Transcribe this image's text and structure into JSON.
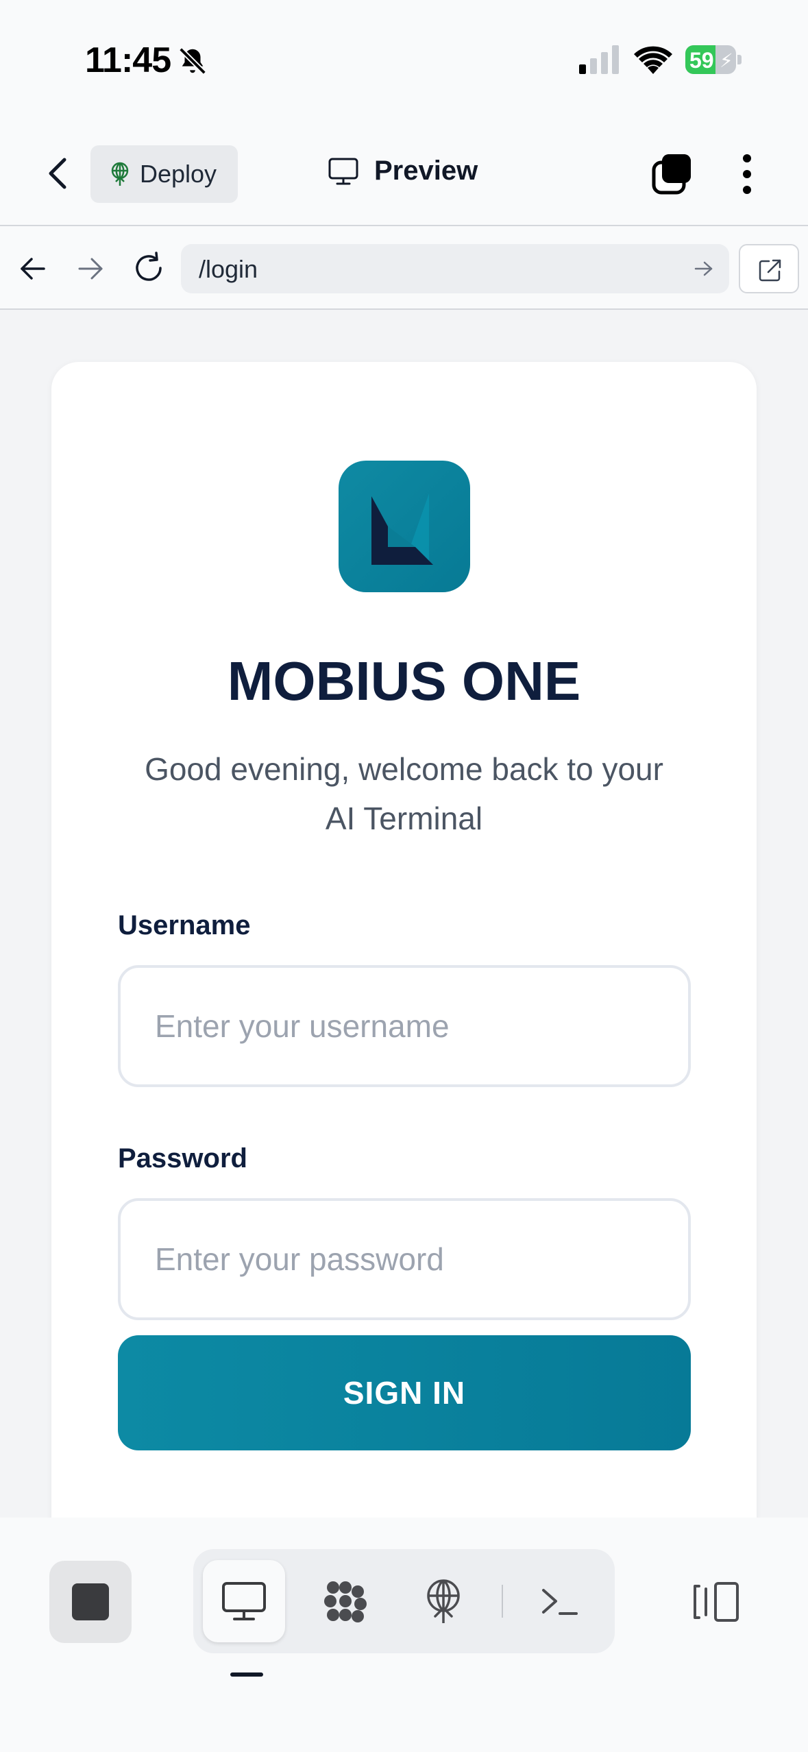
{
  "status_bar": {
    "time": "11:45",
    "battery_level": "59",
    "battery_fraction": 0.59,
    "icons": [
      "bell-slash-icon",
      "cellular-signal-icon",
      "wifi-icon",
      "battery-charging-icon"
    ]
  },
  "header": {
    "deploy_label": "Deploy",
    "title": "Preview"
  },
  "browser": {
    "url": "/login"
  },
  "login": {
    "brand": "MOBIUS ONE",
    "subtitle": "Good evening, welcome back to your AI Terminal",
    "username_label": "Username",
    "username_placeholder": "Enter your username",
    "username_value": "",
    "password_label": "Password",
    "password_placeholder": "Enter your password",
    "password_value": "",
    "submit_label": "SIGN IN"
  },
  "toolbar": {
    "active_tab": "preview",
    "items": [
      "stop-icon",
      "monitor-icon",
      "integrations-icon",
      "deploy-icon",
      "terminal-icon",
      "panel-toggle-icon"
    ]
  },
  "colors": {
    "accent": "#0d8aa4",
    "brand_text": "#0f1e3d",
    "battery_green": "#34c759"
  }
}
